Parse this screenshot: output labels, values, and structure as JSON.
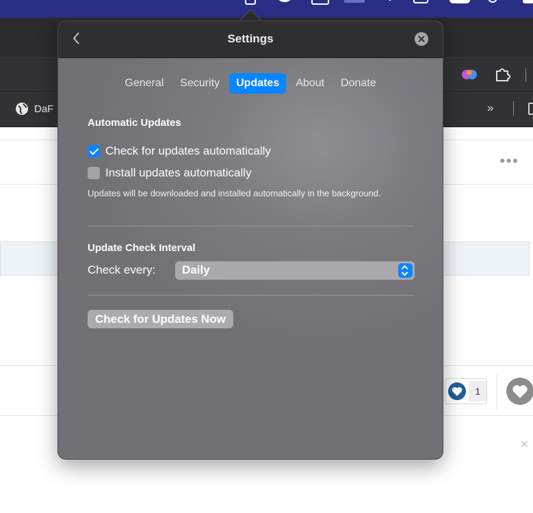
{
  "popover": {
    "title": "Settings",
    "tabs": [
      {
        "label": "General",
        "active": false
      },
      {
        "label": "Security",
        "active": false
      },
      {
        "label": "Updates",
        "active": true
      },
      {
        "label": "About",
        "active": false
      },
      {
        "label": "Donate",
        "active": false
      }
    ],
    "automatic_updates": {
      "heading": "Automatic Updates",
      "check_auto_label": "Check for updates automatically",
      "check_auto_checked": true,
      "install_auto_label": "Install updates automatically",
      "install_auto_checked": false,
      "hint": "Updates will be downloaded and installed automatically in the background."
    },
    "interval": {
      "heading": "Update Check Interval",
      "label": "Check every:",
      "selected": "Daily"
    },
    "check_now_label": "Check for Updates Now"
  },
  "background": {
    "bookmark_label": "DaF",
    "chevrons": "»",
    "like_count": "1"
  },
  "colors": {
    "accent": "#0a84ff",
    "menubar": "#2a2f86",
    "popover_header": "#2f2f32",
    "popover_body": "#7b7b80"
  }
}
